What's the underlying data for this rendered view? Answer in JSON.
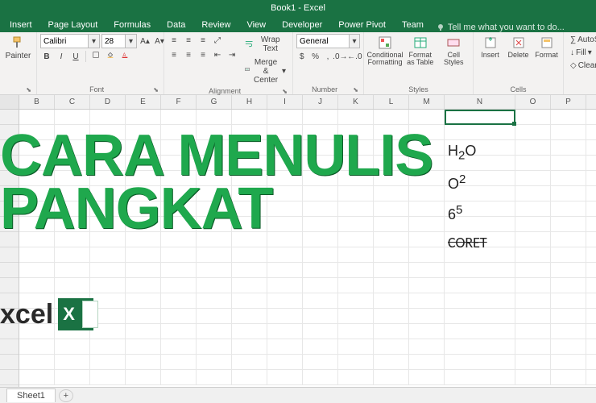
{
  "app": {
    "title": "Book1 - Excel",
    "tellme_placeholder": "Tell me what you want to do..."
  },
  "tabs": [
    "Insert",
    "Page Layout",
    "Formulas",
    "Data",
    "Review",
    "View",
    "Developer",
    "Power Pivot",
    "Team"
  ],
  "ribbon": {
    "clipboard": {
      "painter": "Painter"
    },
    "font": {
      "label": "Font",
      "name": "Calibri",
      "size": "28"
    },
    "alignment": {
      "label": "Alignment",
      "wrap": "Wrap Text",
      "merge": "Merge & Center"
    },
    "number": {
      "label": "Number",
      "format": "General"
    },
    "styles": {
      "label": "Styles",
      "cond": "Conditional Formatting",
      "table": "Format as Table",
      "cell": "Cell Styles"
    },
    "cells": {
      "label": "Cells",
      "insert": "Insert",
      "delete": "Delete",
      "format": "Format"
    },
    "editing": {
      "autosum": "AutoSum",
      "fill": "Fill",
      "clear": "Clear"
    }
  },
  "columns": [
    "B",
    "C",
    "D",
    "E",
    "F",
    "G",
    "H",
    "I",
    "J",
    "K",
    "L",
    "M",
    "N",
    "O",
    "P"
  ],
  "wide_col": "N",
  "selected_cell": "N1",
  "cells": {
    "n3": {
      "base": "H",
      "sub": "2",
      "suffix": "O"
    },
    "n5": {
      "base": "O",
      "sup": "2"
    },
    "n7": {
      "base": "6",
      "sup": "5"
    },
    "n9": "CORET"
  },
  "overlay": {
    "line1": "CARA MENULIS",
    "line2": "PANGKAT",
    "brand": "xcel"
  },
  "sheet": {
    "name": "Sheet1"
  }
}
